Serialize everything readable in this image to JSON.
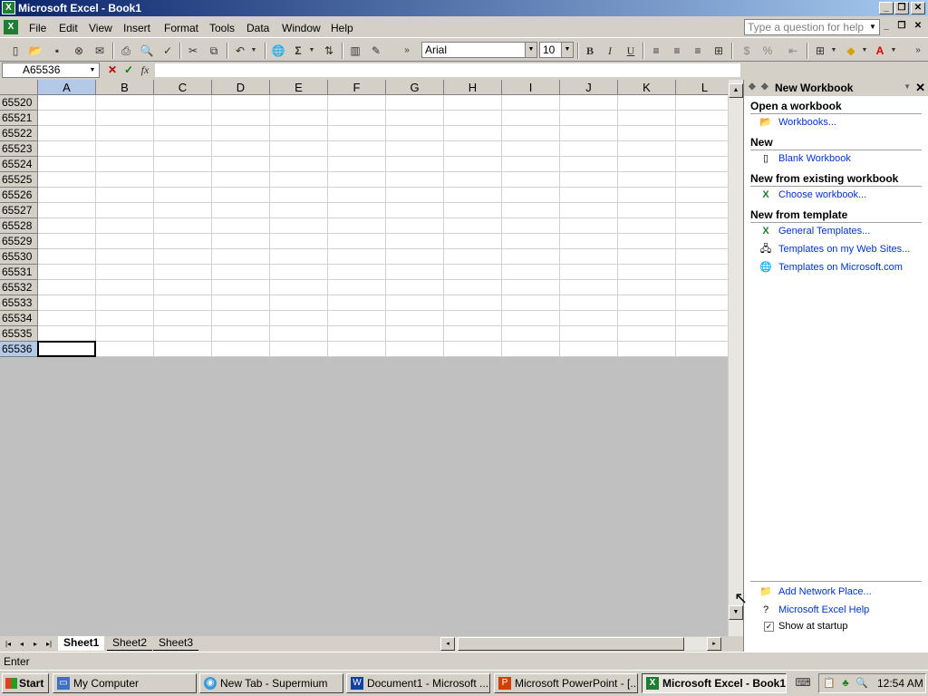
{
  "window": {
    "title": "Microsoft Excel - Book1"
  },
  "menu": {
    "items": [
      "File",
      "Edit",
      "View",
      "Insert",
      "Format",
      "Tools",
      "Data",
      "Window",
      "Help"
    ],
    "help_placeholder": "Type a question for help"
  },
  "toolbar": {
    "font": "Arial",
    "size": "10"
  },
  "formula_bar": {
    "name_box": "A65536",
    "content": ""
  },
  "grid": {
    "columns": [
      "A",
      "B",
      "C",
      "D",
      "E",
      "F",
      "G",
      "H",
      "I",
      "J",
      "K",
      "L"
    ],
    "rows": [
      "65520",
      "65521",
      "65522",
      "65523",
      "65524",
      "65525",
      "65526",
      "65527",
      "65528",
      "65529",
      "65530",
      "65531",
      "65532",
      "65533",
      "65534",
      "65535",
      "65536"
    ],
    "active_cell": "A65536"
  },
  "sheets": [
    "Sheet1",
    "Sheet2",
    "Sheet3"
  ],
  "status": {
    "mode": "Enter"
  },
  "task_pane": {
    "title": "New Workbook",
    "sections": [
      {
        "heading": "Open a workbook",
        "links": [
          "Workbooks..."
        ]
      },
      {
        "heading": "New",
        "links": [
          "Blank Workbook"
        ]
      },
      {
        "heading": "New from existing workbook",
        "links": [
          "Choose workbook..."
        ]
      },
      {
        "heading": "New from template",
        "links": [
          "General Templates...",
          "Templates on my Web Sites...",
          "Templates on Microsoft.com"
        ]
      }
    ],
    "bottom_links": [
      "Add Network Place...",
      "Microsoft Excel Help"
    ],
    "startup_checkbox": {
      "label": "Show at startup",
      "checked": true
    }
  },
  "taskbar": {
    "start": "Start",
    "tasks": [
      "My Computer",
      "New Tab - Supermium",
      "Document1 - Microsoft ...",
      "Microsoft PowerPoint - [...",
      "Microsoft Excel - Book1"
    ],
    "active_task": "Microsoft Excel - Book1",
    "clock": "12:54 AM"
  }
}
